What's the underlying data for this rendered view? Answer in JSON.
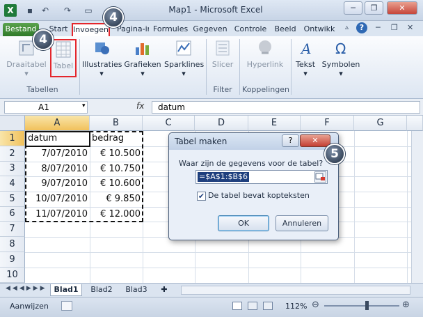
{
  "window": {
    "title": "Map1 - Microsoft Excel"
  },
  "tabs": [
    {
      "label": "Bestand"
    },
    {
      "label": "Start"
    },
    {
      "label": "Invoegen"
    },
    {
      "label": "Pagina-ir"
    },
    {
      "label": "Formules"
    },
    {
      "label": "Gegeven"
    },
    {
      "label": "Controle"
    },
    {
      "label": "Beeld"
    },
    {
      "label": "Ontwikk"
    }
  ],
  "ribbon": {
    "pivot_label": "Draaitabel",
    "table_label": "Tabel",
    "illustrations_label": "Illustraties",
    "charts_label": "Grafieken",
    "sparklines_label": "Sparklines",
    "slicer_label": "Slicer",
    "hyperlink_label": "Hyperlink",
    "text_label": "Tekst",
    "symbols_label": "Symbolen",
    "groups": {
      "tables": "Tabellen",
      "filter": "Filter",
      "links": "Koppelingen"
    }
  },
  "formula_bar": {
    "name_box": "A1",
    "fx": "fx",
    "formula": "datum"
  },
  "columns": [
    "A",
    "B",
    "C",
    "D",
    "E",
    "F",
    "G"
  ],
  "rows": [
    "1",
    "2",
    "3",
    "4",
    "5",
    "6",
    "7",
    "8",
    "9",
    "10"
  ],
  "cells": {
    "header": [
      "datum",
      "bedrag"
    ],
    "data": [
      [
        "7/07/2010",
        "€ 10.500"
      ],
      [
        "8/07/2010",
        "€ 10.750"
      ],
      [
        "9/07/2010",
        "€ 10.600"
      ],
      [
        "10/07/2010",
        "€ 9.850"
      ],
      [
        "11/07/2010",
        "€ 12.000"
      ]
    ]
  },
  "sheets": {
    "tabs": [
      "Blad1",
      "Blad2",
      "Blad3"
    ]
  },
  "status": {
    "ready": "Aanwijzen",
    "zoom": "112%"
  },
  "dialog": {
    "title": "Tabel maken",
    "help": "?",
    "question": "Waar zijn de gegevens voor de tabel?",
    "range": "=$A$1:$B$6",
    "checkbox_checked": true,
    "checkbox_label": "De tabel bevat kopteksten",
    "ok": "OK",
    "cancel": "Annuleren"
  },
  "callouts": {
    "step_tab": "4",
    "step_table": "4",
    "step_dialog": "5"
  }
}
